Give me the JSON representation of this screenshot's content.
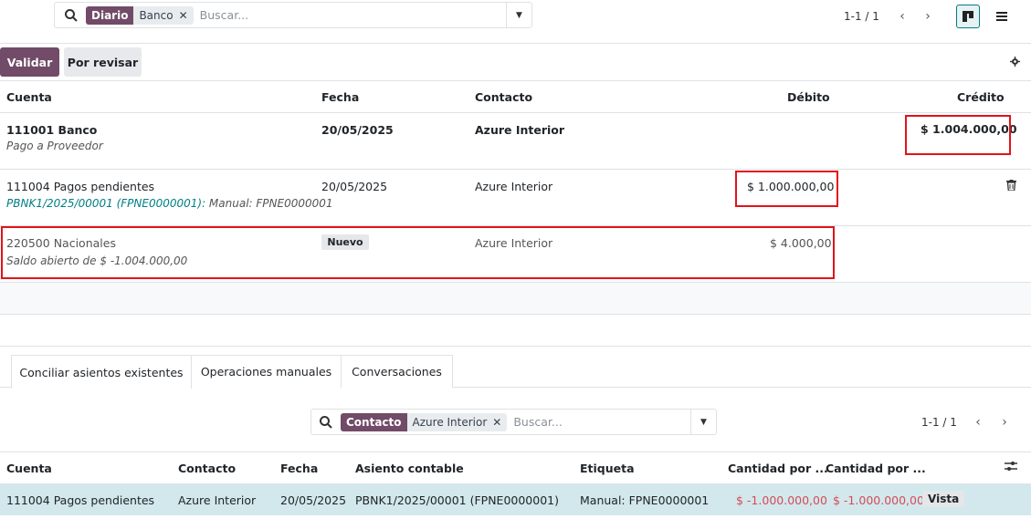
{
  "top_search": {
    "facet_key": "Diario",
    "facet_value": "Banco",
    "facet_remove": "✕",
    "placeholder": "Buscar..."
  },
  "top_pager": {
    "text": "1-1 / 1"
  },
  "actions": {
    "validar": "Validar",
    "por_revisar": "Por revisar"
  },
  "entries_table": {
    "headers": {
      "cuenta": "Cuenta",
      "fecha": "Fecha",
      "contacto": "Contacto",
      "debito": "Débito",
      "credito": "Crédito"
    },
    "rows": [
      {
        "cuenta": "111001 Banco",
        "sub": "Pago a Proveedor",
        "fecha": "20/05/2025",
        "contacto": "Azure Interior",
        "debito": "",
        "credito": "$ 1.004.000,00"
      },
      {
        "cuenta": "111004 Pagos pendientes",
        "sub_link": "PBNK1/2025/00001 (FPNE0000001):",
        "sub_rest": " Manual: FPNE0000001",
        "fecha": "20/05/2025",
        "contacto": "Azure Interior",
        "debito": "$ 1.000.000,00",
        "credito": ""
      },
      {
        "cuenta": "220500 Nacionales",
        "sub": "Saldo abierto de $ -1.004.000,00",
        "badge": "Nuevo",
        "contacto": "Azure Interior",
        "debito": "$ 4.000,00",
        "credito": ""
      }
    ]
  },
  "tabs": [
    {
      "label": "Conciliar asientos existentes"
    },
    {
      "label": "Operaciones manuales"
    },
    {
      "label": "Conversaciones"
    }
  ],
  "bottom_search": {
    "facet_key": "Contacto",
    "facet_value": "Azure Interior",
    "facet_remove": "✕",
    "placeholder": "Buscar..."
  },
  "bottom_pager": {
    "text": "1-1 / 1"
  },
  "matches_table": {
    "headers": {
      "cuenta": "Cuenta",
      "contacto": "Contacto",
      "fecha": "Fecha",
      "asiento": "Asiento contable",
      "etiqueta": "Etiqueta",
      "cant1": "Cantidad por ...",
      "cant2": "Cantidad por ..."
    },
    "row": {
      "cuenta": "111004 Pagos pendientes",
      "contacto": "Azure Interior",
      "fecha": "20/05/2025",
      "asiento": "PBNK1/2025/00001 (FPNE0000001)",
      "etiqueta": "Manual: FPNE0000001",
      "cant1": "$ -1.000.000,00",
      "cant2": "$ -1.000.000,00",
      "vista": "Vista"
    }
  },
  "colors": {
    "brand": "#714b67",
    "highlight_box": "#e0141a",
    "selected_row": "#d2e8ec",
    "negative": "#d44c59",
    "link": "#017e84"
  }
}
